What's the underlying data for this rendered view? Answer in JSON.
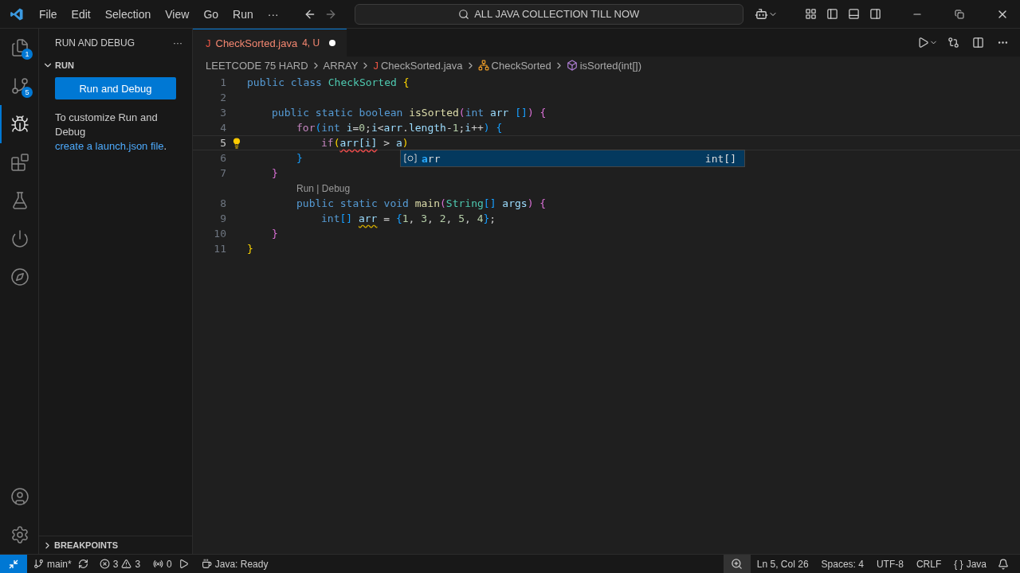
{
  "menu": [
    "File",
    "Edit",
    "Selection",
    "View",
    "Go",
    "Run",
    "···"
  ],
  "command_center": {
    "text": "ALL JAVA COLLECTION TILL NOW"
  },
  "activity_bar": [
    {
      "kind": "files",
      "badge": "1",
      "selected": false
    },
    {
      "kind": "source-control",
      "badge": "5",
      "selected": false
    },
    {
      "kind": "run-debug",
      "selected": true
    },
    {
      "kind": "extensions",
      "selected": false
    },
    {
      "kind": "testing",
      "selected": false
    },
    {
      "kind": "power",
      "selected": false
    },
    {
      "kind": "remote",
      "selected": false
    }
  ],
  "sidebar": {
    "title": "RUN AND DEBUG",
    "more": "···",
    "section": "RUN",
    "button": "Run and Debug",
    "text_before": "To customize Run and Debug ",
    "link": "create a launch.json file",
    "text_after": ".",
    "footer_section": "BREAKPOINTS"
  },
  "tabs": [
    {
      "icon": "J",
      "name": "CheckSorted.java",
      "status": "4, U",
      "modified": true,
      "selected": true
    }
  ],
  "breadcrumbs": [
    {
      "kind": "folder",
      "text": "LEETCODE 75 HARD"
    },
    {
      "kind": "folder",
      "text": "ARRAY"
    },
    {
      "kind": "file",
      "icon": "J",
      "text": "CheckSorted.java"
    },
    {
      "kind": "class",
      "text": "CheckSorted"
    },
    {
      "kind": "method",
      "text": "isSorted(int[])"
    }
  ],
  "code": [
    {
      "number": "1",
      "current": false,
      "tokens": [
        {
          "kind": "kw",
          "text": "public class "
        },
        {
          "kind": "cls",
          "text": "CheckSorted "
        },
        {
          "kind": "b1",
          "text": "{"
        }
      ],
      "children": [
        {
          "number": "2",
          "current": false
        },
        {
          "number": "3",
          "current": false,
          "tokens": [
            {
              "kind": "kw",
              "text": "public static boolean "
            },
            {
              "kind": "fn",
              "text": "isSorted"
            },
            {
              "kind": "b2",
              "text": "("
            },
            {
              "kind": "kw",
              "text": "int "
            },
            {
              "kind": "var",
              "text": "arr "
            },
            {
              "kind": "b3",
              "text": "[]"
            },
            {
              "kind": "b2",
              "text": ") {"
            }
          ],
          "children": [
            {
              "number": "4",
              "current": false,
              "tokens": [
                {
                  "kind": "ctl",
                  "text": "for"
                },
                {
                  "kind": "b3",
                  "text": "("
                },
                {
                  "kind": "kw",
                  "text": "int "
                },
                {
                  "kind": "var",
                  "text": "i"
                },
                {
                  "kind": "plain",
                  "text": "="
                },
                {
                  "kind": "num",
                  "text": "0"
                },
                {
                  "kind": "plain",
                  "text": ";"
                },
                {
                  "kind": "var",
                  "text": "i"
                },
                {
                  "kind": "plain",
                  "text": "<"
                },
                {
                  "kind": "var",
                  "text": "arr"
                },
                {
                  "kind": "plain",
                  "text": "."
                },
                {
                  "kind": "var",
                  "text": "length"
                },
                {
                  "kind": "plain",
                  "text": "-"
                },
                {
                  "kind": "num",
                  "text": "1"
                },
                {
                  "kind": "plain",
                  "text": ";"
                },
                {
                  "kind": "var",
                  "text": "i"
                },
                {
                  "kind": "plain",
                  "text": "++"
                },
                {
                  "kind": "b3",
                  "text": ") {"
                }
              ],
              "children": [
                {
                  "number": "5",
                  "current": true,
                  "lightbulb": true,
                  "tokens": [
                    {
                      "kind": "ctl",
                      "text": "if"
                    },
                    {
                      "kind": "b1",
                      "text": "("
                    },
                    {
                      "kind": "err",
                      "text": "arr[i]"
                    },
                    {
                      "kind": "plain",
                      "text": " > "
                    },
                    {
                      "kind": "var",
                      "text": "a"
                    },
                    {
                      "kind": "b1",
                      "text": ")"
                    }
                  ],
                  "suggest": [
                    {
                      "match": "a",
                      "rest": "rr",
                      "type": "int[]",
                      "selected": true
                    }
                  ]
                }
              ]
            },
            {
              "number": "6",
              "current": false,
              "tokens": [
                {
                  "kind": "b3",
                  "text": "}"
                }
              ]
            }
          ]
        },
        {
          "number": "7",
          "current": false,
          "tokens": [
            {
              "kind": "b2",
              "text": "}"
            }
          ],
          "children": [
            {
              "number": "8",
              "current": false,
              "codelens": "Run | Debug",
              "tokens": [
                {
                  "kind": "kw",
                  "text": "public static void "
                },
                {
                  "kind": "fn",
                  "text": "main"
                },
                {
                  "kind": "b2",
                  "text": "("
                },
                {
                  "kind": "cls",
                  "text": "String"
                },
                {
                  "kind": "b3",
                  "text": "[] "
                },
                {
                  "kind": "var",
                  "text": "args"
                },
                {
                  "kind": "b2",
                  "text": ") {"
                }
              ],
              "children": [
                {
                  "number": "9",
                  "current": false,
                  "tokens": [
                    {
                      "kind": "kw",
                      "text": "int"
                    },
                    {
                      "kind": "b3",
                      "text": "[] "
                    },
                    {
                      "kind": "warn",
                      "text": "arr"
                    },
                    {
                      "kind": "plain",
                      "text": " = "
                    },
                    {
                      "kind": "b3",
                      "text": "{"
                    },
                    {
                      "kind": "num",
                      "text": "1"
                    },
                    {
                      "kind": "plain",
                      "text": ", "
                    },
                    {
                      "kind": "num",
                      "text": "3"
                    },
                    {
                      "kind": "plain",
                      "text": ", "
                    },
                    {
                      "kind": "num",
                      "text": "2"
                    },
                    {
                      "kind": "plain",
                      "text": ", "
                    },
                    {
                      "kind": "num",
                      "text": "5"
                    },
                    {
                      "kind": "plain",
                      "text": ", "
                    },
                    {
                      "kind": "num",
                      "text": "4"
                    },
                    {
                      "kind": "b3",
                      "text": "}"
                    },
                    {
                      "kind": "plain",
                      "text": ";"
                    }
                  ]
                }
              ]
            }
          ]
        },
        {
          "number": "10",
          "current": false,
          "tokens": [
            {
              "kind": "b2",
              "text": "}"
            }
          ]
        }
      ]
    },
    {
      "number": "11",
      "current": false,
      "tokens": [
        {
          "kind": "b1",
          "text": "}"
        }
      ]
    }
  ],
  "status_bar": {
    "branch": "main*",
    "errors": "3",
    "warnings": "3",
    "ports": "0",
    "java": "Java: Ready",
    "position": "Ln 5, Col 26",
    "spaces": "Spaces: 4",
    "encoding": "UTF-8",
    "eol": "CRLF",
    "braces": "{ }",
    "language": "Java"
  }
}
